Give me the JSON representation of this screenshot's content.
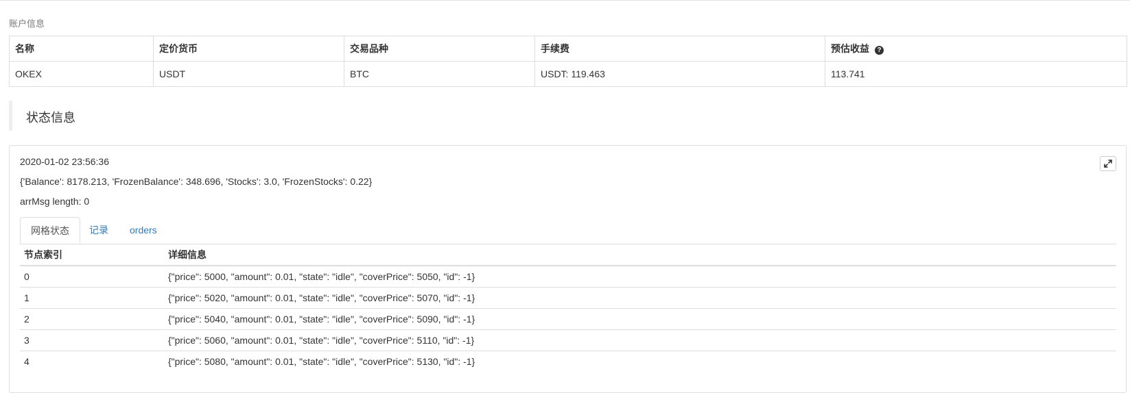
{
  "account_section": {
    "caption": "账户信息",
    "headers": [
      "名称",
      "定价货币",
      "交易品种",
      "手续费",
      "预估收益"
    ],
    "row": [
      "OKEX",
      "USDT",
      "BTC",
      "USDT: 119.463",
      "113.741"
    ]
  },
  "status_section": {
    "title": "状态信息",
    "timestamp": "2020-01-02 23:56:36",
    "balance_line": "{'Balance': 8178.213, 'FrozenBalance': 348.696, 'Stocks': 3.0, 'FrozenStocks': 0.22}",
    "arrmsg_line": "arrMsg length: 0",
    "tabs": [
      "网格状态",
      "记录",
      "orders"
    ],
    "grid_table": {
      "headers": [
        "节点索引",
        "详细信息"
      ],
      "rows": [
        [
          "0",
          "{\"price\": 5000, \"amount\": 0.01, \"state\": \"idle\", \"coverPrice\": 5050, \"id\": -1}"
        ],
        [
          "1",
          "{\"price\": 5020, \"amount\": 0.01, \"state\": \"idle\", \"coverPrice\": 5070, \"id\": -1}"
        ],
        [
          "2",
          "{\"price\": 5040, \"amount\": 0.01, \"state\": \"idle\", \"coverPrice\": 5090, \"id\": -1}"
        ],
        [
          "3",
          "{\"price\": 5060, \"amount\": 0.01, \"state\": \"idle\", \"coverPrice\": 5110, \"id\": -1}"
        ],
        [
          "4",
          "{\"price\": 5080, \"amount\": 0.01, \"state\": \"idle\", \"coverPrice\": 5130, \"id\": -1}"
        ]
      ]
    }
  },
  "icons": {
    "help": "question-circle-icon",
    "expand": "expand-arrows-icon"
  },
  "colors": {
    "link": "#337ab7",
    "border": "#dddddd",
    "text": "#333333"
  }
}
